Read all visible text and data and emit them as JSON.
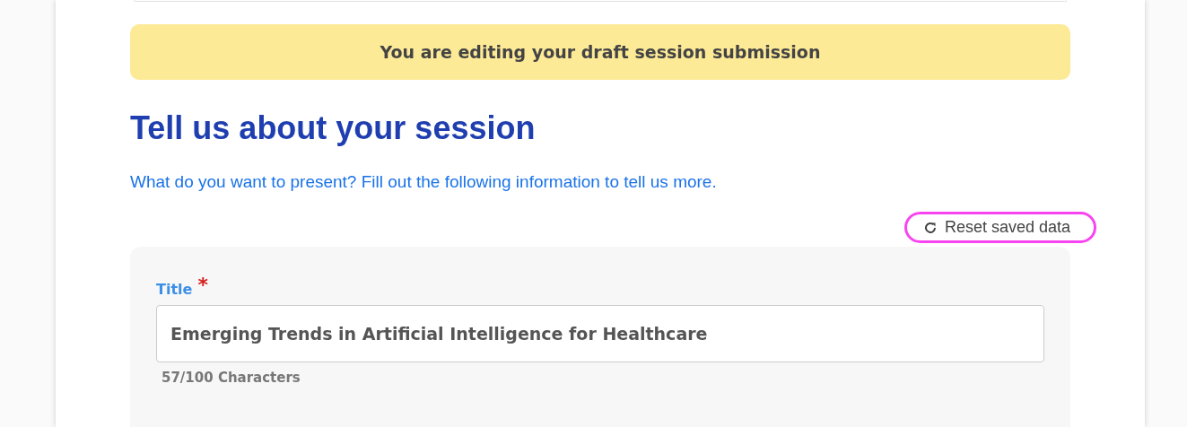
{
  "banner": {
    "text": "You are editing your draft session submission"
  },
  "heading": "Tell us about your session",
  "intro": "What do you want to present? Fill out the following information to tell us more.",
  "reset_button": {
    "label": "Reset saved data",
    "highlighted": true
  },
  "form": {
    "fields": [
      {
        "label": "Title",
        "required_mark": "*",
        "value": "Emerging Trends in Artificial Intelligence for Healthcare",
        "counter": "57/100 Characters"
      }
    ]
  }
}
